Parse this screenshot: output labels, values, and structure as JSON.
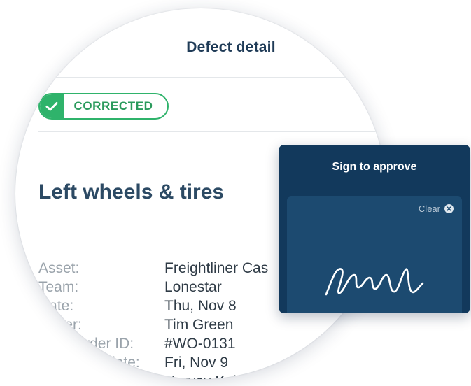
{
  "header": {
    "title": "Defect detail"
  },
  "status": {
    "label": "CORRECTED",
    "icon": "check-icon",
    "color": "#2fb36b"
  },
  "defect": {
    "title": "Left wheels & tires"
  },
  "details": [
    {
      "label": "Asset:",
      "value": "Freightliner Cas"
    },
    {
      "label": "Team:",
      "value": "Lonestar"
    },
    {
      "label": "Date:",
      "value": "Thu, Nov 8"
    },
    {
      "label": "Driver:",
      "value": "Tim Green"
    },
    {
      "label": "Work order ID:",
      "value": "#WO-0131"
    },
    {
      "label": "Corrected date:",
      "value": "Fri, Nov 9"
    },
    {
      "label": "",
      "value": "Harvey Keitel"
    }
  ],
  "signature": {
    "title": "Sign to approve",
    "clear_label": "Clear",
    "clear_icon": "close-circle-icon",
    "card_color": "#12395c",
    "pad_color": "#1c4a70"
  }
}
